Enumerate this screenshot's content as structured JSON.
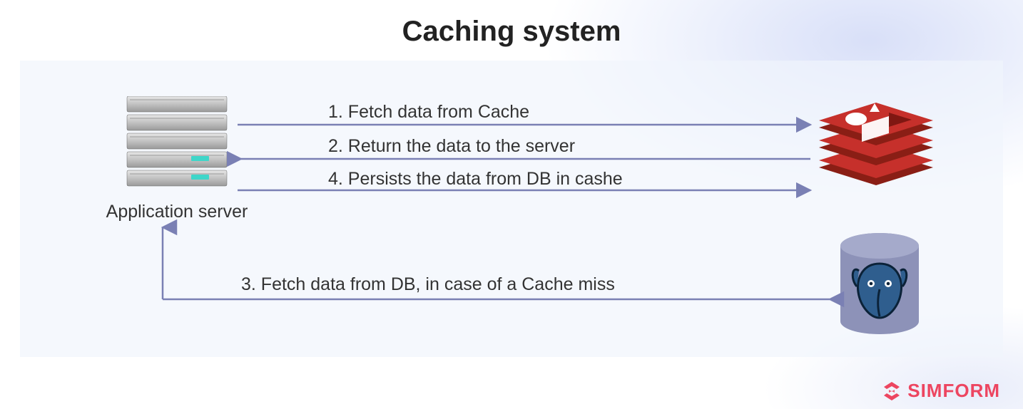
{
  "title": "Caching system",
  "nodes": {
    "app_server": "Application server"
  },
  "arrows": {
    "a1": "1. Fetch data from Cache",
    "a2": "2. Return the data to the server",
    "a3": "3. Fetch data from DB, in case of a Cache miss",
    "a4": "4. Persists the data from DB in cashe"
  },
  "logo": "SIMFORM"
}
